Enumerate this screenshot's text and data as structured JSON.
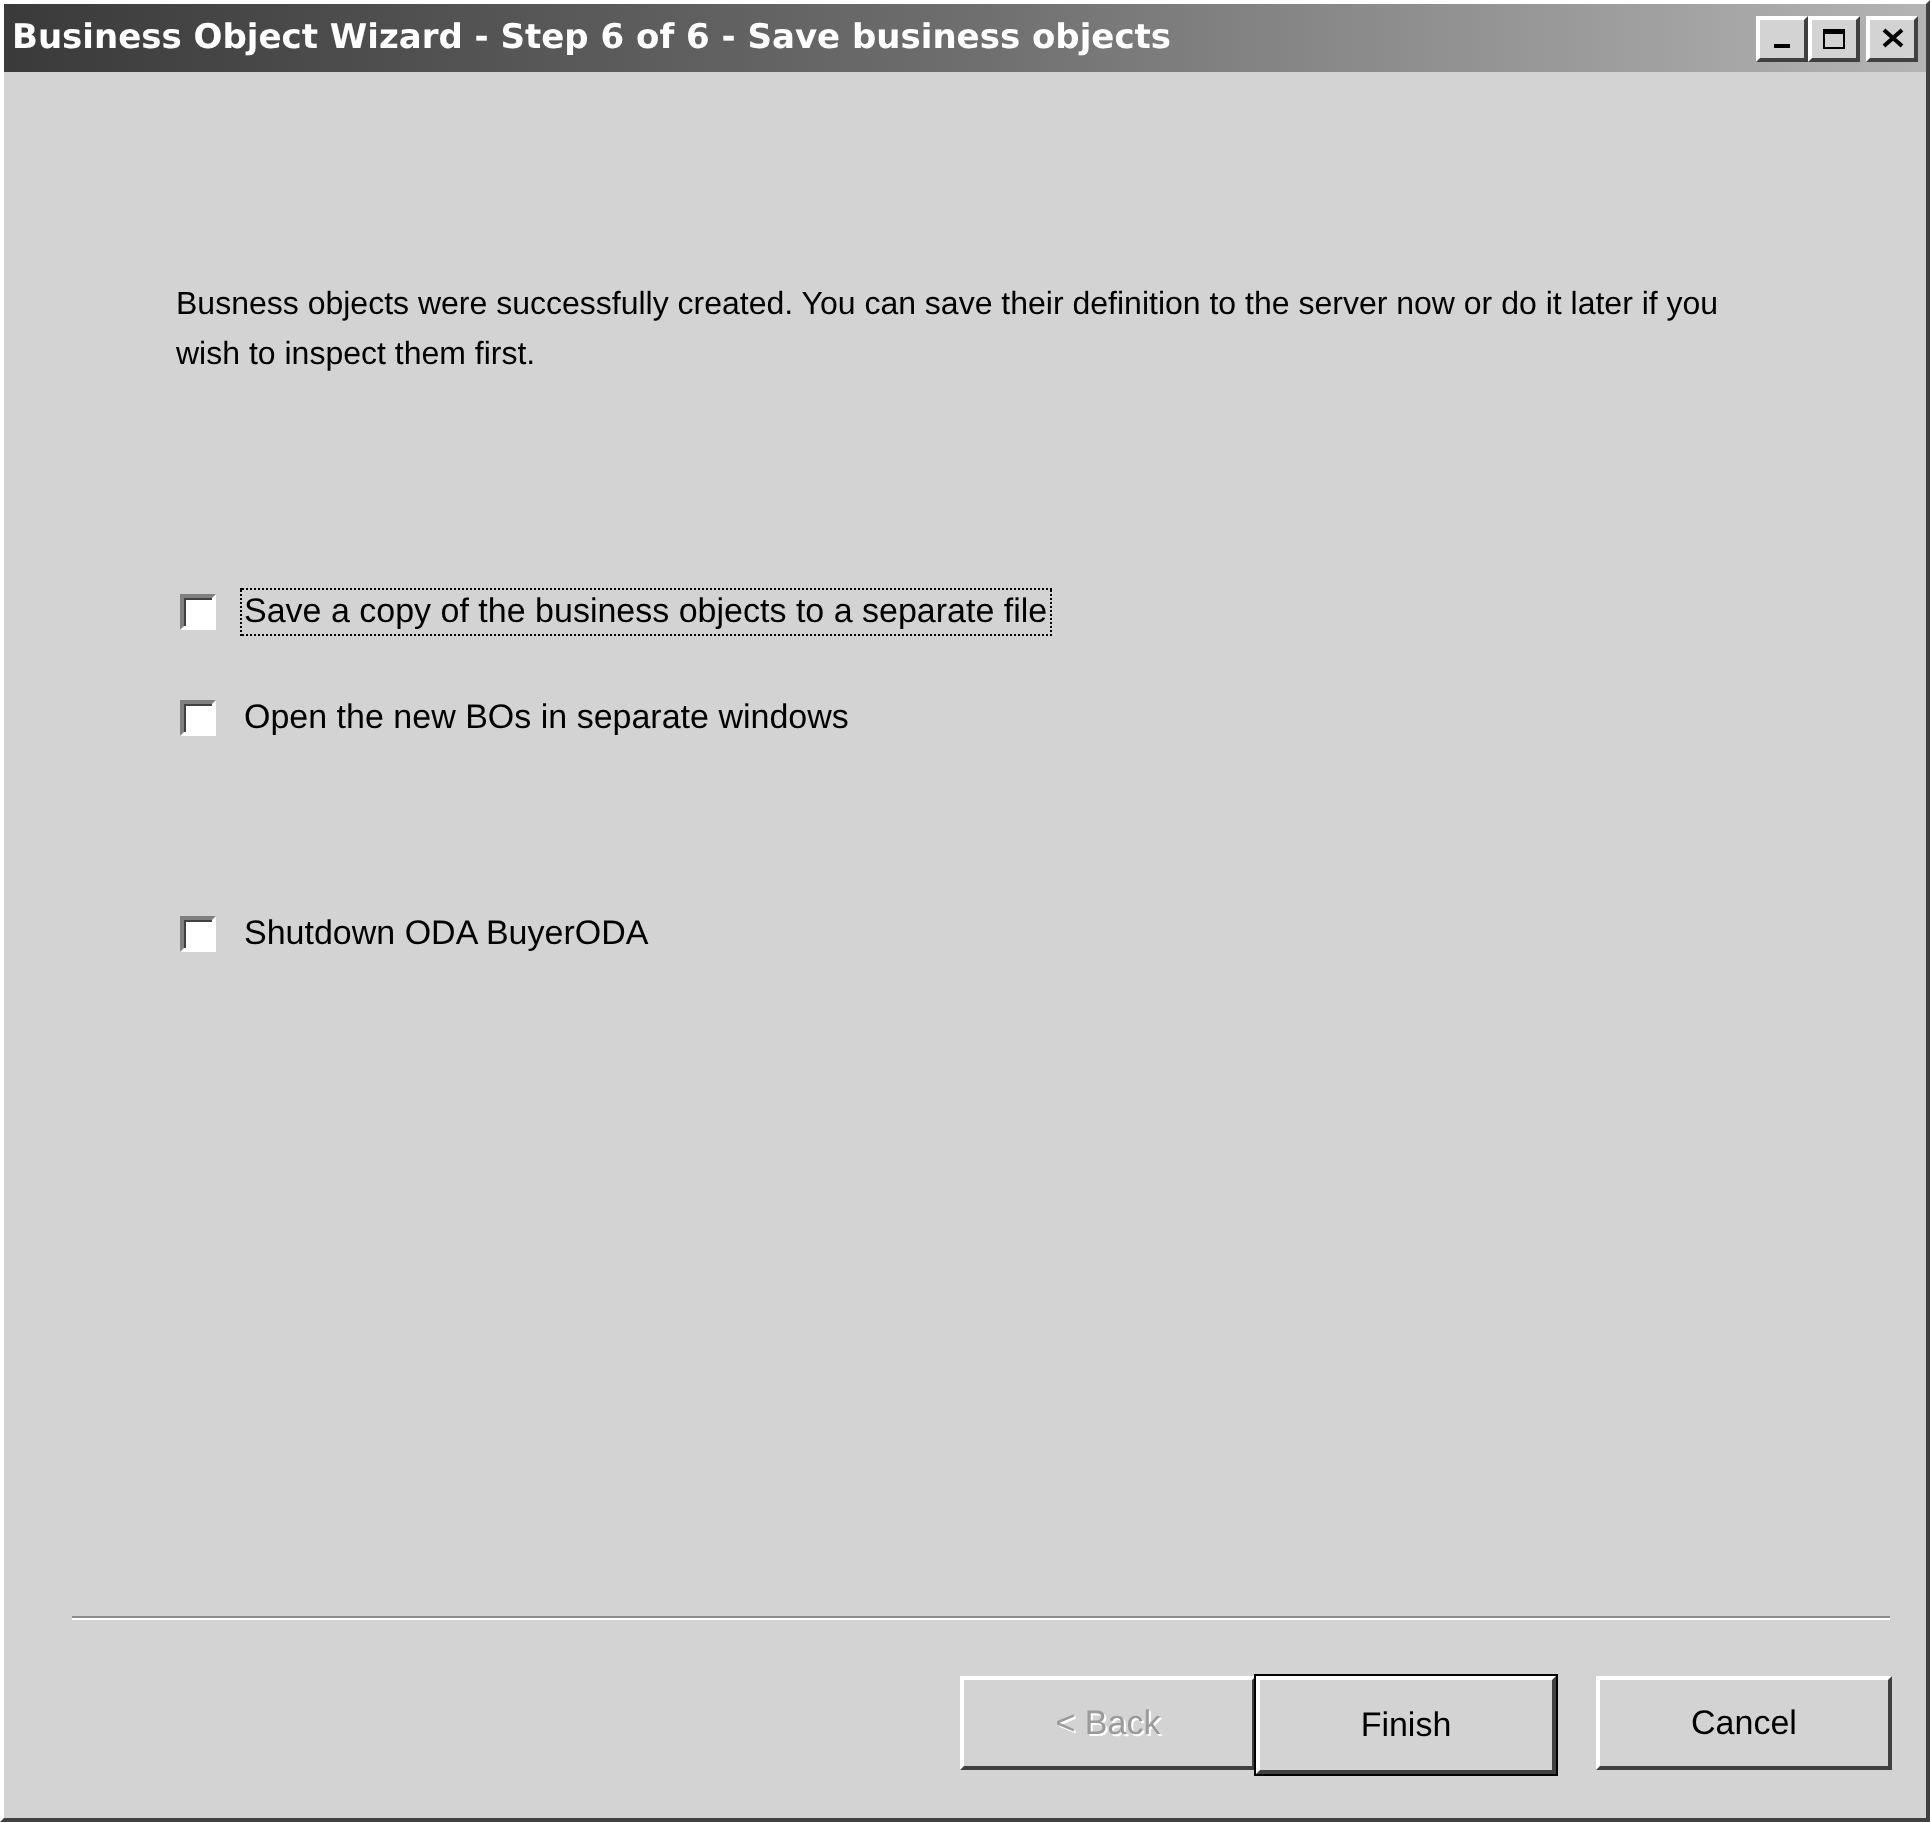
{
  "window": {
    "title": "Business Object Wizard - Step 6 of 6 - Save business objects",
    "controls": [
      {
        "kind": "minimize"
      },
      {
        "kind": "maximize"
      },
      {
        "kind": "close"
      }
    ]
  },
  "message": "Busness objects were successfully created. You can save their definition to the server now or do it later if you wish to inspect them first.",
  "options": [
    {
      "label": "Save a copy of the business objects to a separate file",
      "checked": false,
      "focused": true
    },
    {
      "label": "Open the new BOs in separate windows",
      "checked": false,
      "focused": false
    },
    {
      "label": "Shutdown ODA BuyerODA",
      "checked": false,
      "focused": false
    }
  ],
  "buttons": [
    {
      "label": "< Back",
      "disabled": true,
      "default": false
    },
    {
      "label": "Finish",
      "disabled": false,
      "default": true
    },
    {
      "label": "Cancel",
      "disabled": false,
      "default": false
    }
  ]
}
